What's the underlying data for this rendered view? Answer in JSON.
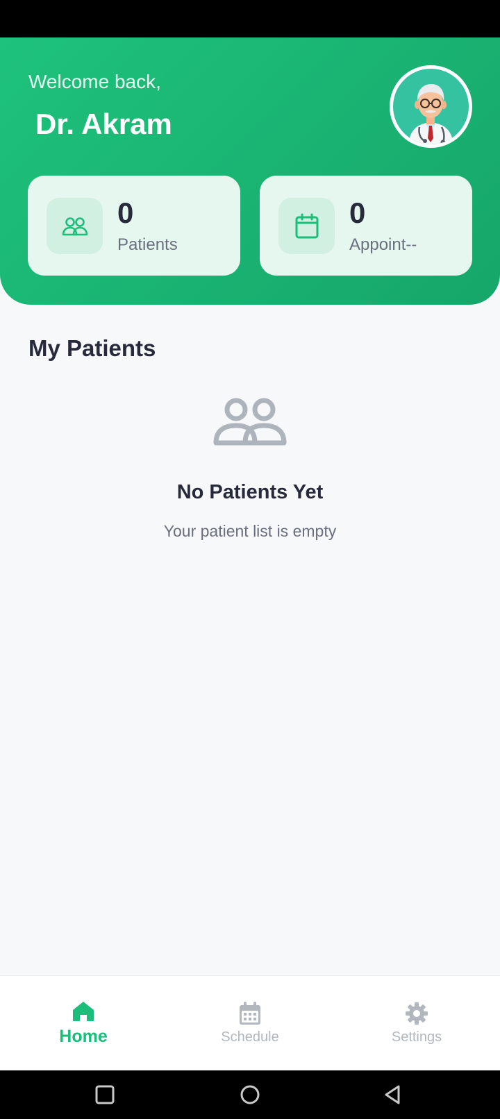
{
  "colors": {
    "brand": "#1ec27c",
    "brand_dark": "#16a66a",
    "card_bg": "#e6f7ef",
    "text_dark": "#262a3a",
    "text_muted": "#6a6f7d",
    "nav_inactive": "#b2b6bd"
  },
  "header": {
    "greeting": "Welcome back,",
    "doctor_name": "Dr. Akram",
    "avatar_icon": "doctor-avatar"
  },
  "stats": [
    {
      "value": "0",
      "label": "Patients",
      "icon": "people-icon"
    },
    {
      "value": "0",
      "label": "Appoint--",
      "icon": "calendar-icon"
    }
  ],
  "patients_section": {
    "title": "My Patients",
    "empty_icon": "people-icon",
    "empty_title": "No Patients Yet",
    "empty_subtitle": "Your patient list is empty"
  },
  "bottom_nav": {
    "active": "Home",
    "items": [
      {
        "label": "Home",
        "icon": "home-icon"
      },
      {
        "label": "Schedule",
        "icon": "calendar-icon"
      },
      {
        "label": "Settings",
        "icon": "gear-icon"
      }
    ]
  },
  "system_nav": [
    "recent-apps-icon",
    "home-circle-icon",
    "back-icon"
  ]
}
